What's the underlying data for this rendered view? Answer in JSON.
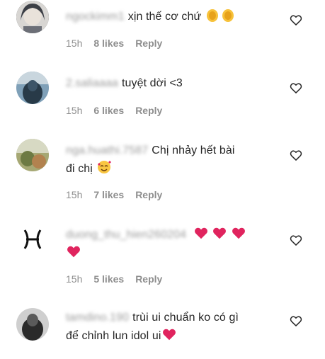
{
  "comments": [
    {
      "username": "ngockimm1",
      "text": "xịn thế cơ chứ",
      "emoji": "clap-clap",
      "time": "15h",
      "likes": "8 likes",
      "reply": "Reply",
      "avatar_color": "#3c3f46"
    },
    {
      "username": "2.saliaaaa",
      "text": "tuyệt dời <3",
      "emoji": "",
      "time": "15h",
      "likes": "6 likes",
      "reply": "Reply",
      "avatar_color": "#334a5c"
    },
    {
      "username": "nga.huathi.7587",
      "text": "Chị nhảy hết bài",
      "text2": "đi chị",
      "emoji": "smiling-face-with-hearts",
      "time": "15h",
      "likes": "7 likes",
      "reply": "Reply",
      "avatar_color": "#8a8f5a"
    },
    {
      "username": "duong_thu_hien260204",
      "text": "",
      "emoji": "three-red-hearts",
      "time": "15h",
      "likes": "5 likes",
      "reply": "Reply",
      "avatar_color": "#ffffff"
    },
    {
      "username": "tamdino.190",
      "text": "trùi ui chuẩn ko có gì",
      "text2": "để chỉnh lun idol ui",
      "emoji": "red-heart",
      "time": "",
      "likes": "",
      "reply": "",
      "avatar_color": "#2a2a2a"
    }
  ],
  "colors": {
    "heart": "#e0245e",
    "meta": "#8e8e8e",
    "text": "#262626"
  }
}
